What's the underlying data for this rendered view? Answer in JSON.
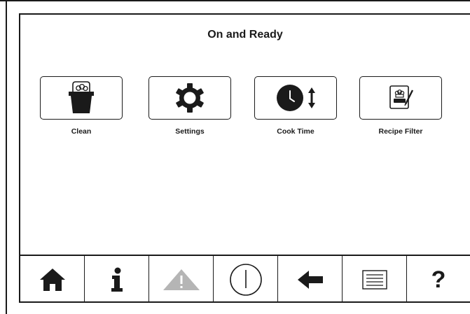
{
  "header": {
    "title": "On and Ready"
  },
  "tiles": [
    {
      "label": "Clean",
      "icon": "bucket-icon"
    },
    {
      "label": "Settings",
      "icon": "gear-icon"
    },
    {
      "label": "Cook Time",
      "icon": "clock-adjust-icon"
    },
    {
      "label": "Recipe Filter",
      "icon": "recipe-filter-icon"
    }
  ],
  "navbar": {
    "items": [
      "home-icon",
      "info-icon",
      "warning-icon",
      "power-icon",
      "back-arrow-icon",
      "menu-list-icon",
      "help-icon"
    ],
    "help_label": "?"
  },
  "colors": {
    "ink": "#1a1a1a",
    "disabled": "#b5b5b5",
    "background": "#ffffff"
  }
}
